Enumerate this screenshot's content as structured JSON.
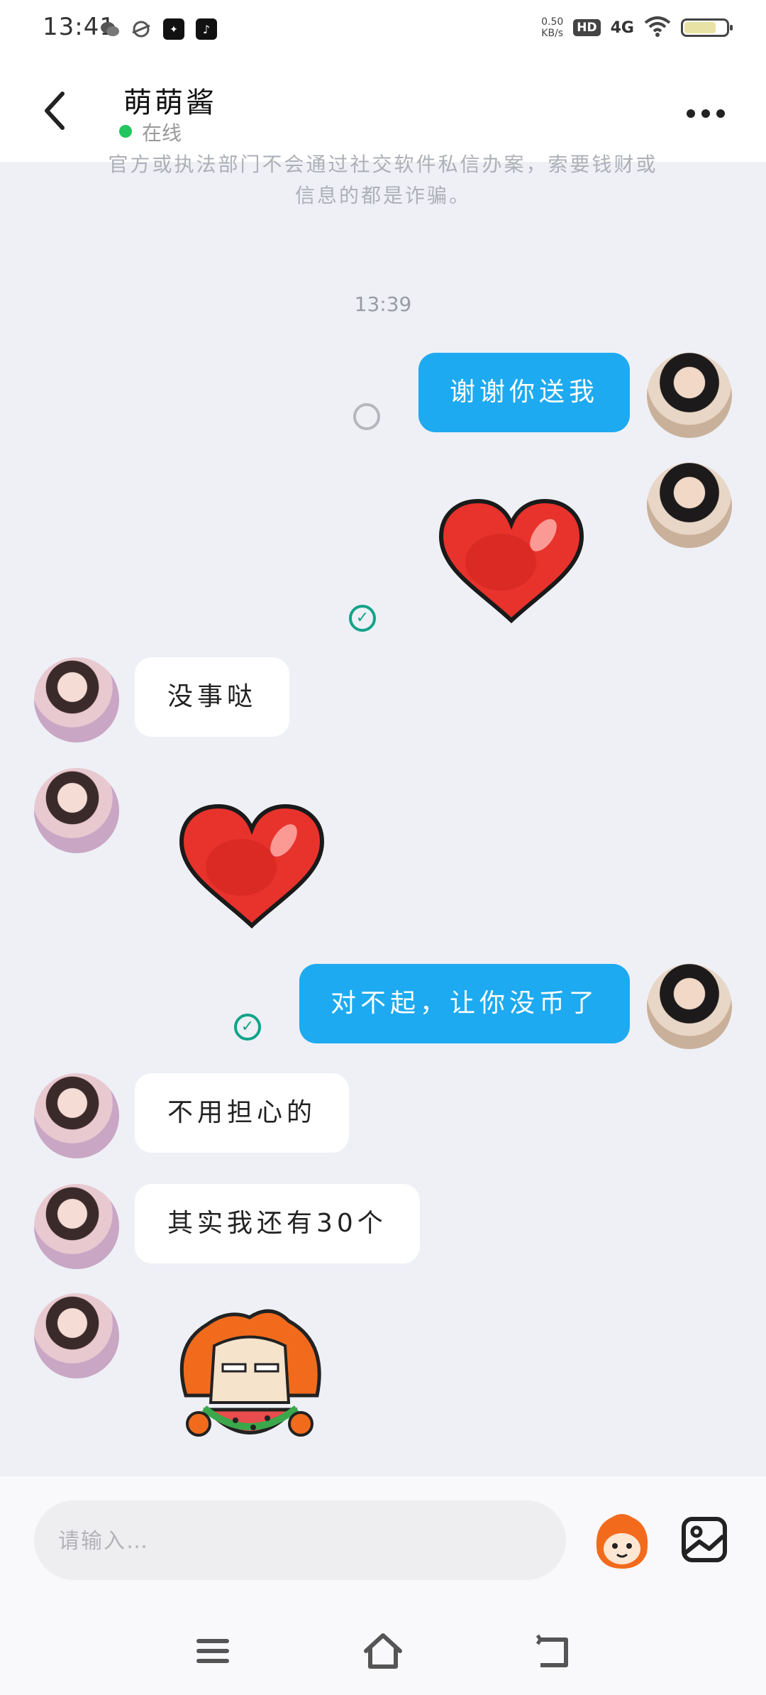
{
  "status_bar": {
    "time": "13:41",
    "network_speed_value": "0.50",
    "network_speed_unit": "KB/s",
    "hd_label": "HD",
    "network_type": "4G",
    "battery_level": 0.75
  },
  "header": {
    "contact_name": "萌萌酱",
    "online_status": "在线"
  },
  "notice": {
    "line1": "官方或执法部门不会通过社交软件私信办案，索要钱财或",
    "line2": "信息的都是诈骗。"
  },
  "chat": {
    "time_separator": "13:39",
    "messages": [
      {
        "direction": "out",
        "type": "text",
        "text": "谢谢你送我",
        "status": "pending"
      },
      {
        "direction": "out",
        "type": "sticker",
        "sticker": "red-heart",
        "status": "read"
      },
      {
        "direction": "in",
        "type": "text",
        "text": "没事哒"
      },
      {
        "direction": "in",
        "type": "sticker",
        "sticker": "red-heart"
      },
      {
        "direction": "out",
        "type": "text",
        "text": "对不起，让你没币了",
        "status": "read"
      },
      {
        "direction": "in",
        "type": "text",
        "text": "不用担心的"
      },
      {
        "direction": "in",
        "type": "text",
        "text": "其实我还有30个"
      },
      {
        "direction": "in",
        "type": "sticker",
        "sticker": "watermelon-mascot"
      }
    ]
  },
  "composer": {
    "placeholder": "请输入…",
    "emoji_icon": "mascot-emoji-icon",
    "image_icon": "image-icon"
  },
  "nav": {
    "icons": [
      "menu-icon",
      "home-icon",
      "back-icon"
    ]
  },
  "colors": {
    "outgoing_bubble": "#1daaf0",
    "incoming_bubble": "#ffffff",
    "read_check": "#12a38a",
    "online_dot": "#22c55e",
    "background": "#eef0f6"
  }
}
